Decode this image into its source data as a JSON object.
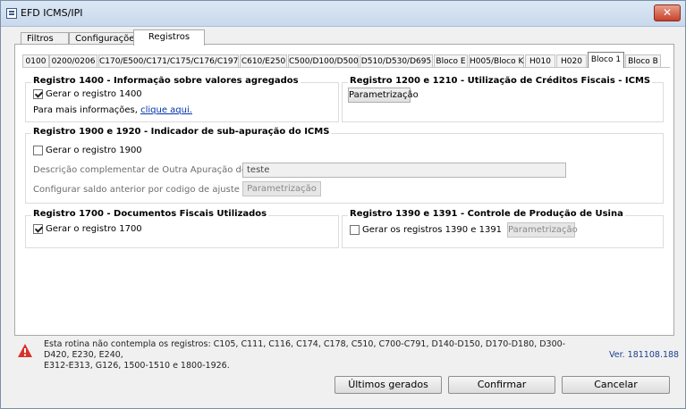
{
  "window": {
    "title": "EFD ICMS/IPI",
    "close_glyph": "✕"
  },
  "main_tabs": [
    {
      "label": "Filtros"
    },
    {
      "label": "Configurações"
    },
    {
      "label": "Registros",
      "active": true
    }
  ],
  "sub_tabs": [
    {
      "label": "0100"
    },
    {
      "label": "0200/0206"
    },
    {
      "label": "C170/E500/C171/C175/C176/C197"
    },
    {
      "label": "C610/E250"
    },
    {
      "label": "C500/D100/D500"
    },
    {
      "label": "D510/D530/D695"
    },
    {
      "label": "Bloco E"
    },
    {
      "label": "H005/Bloco K"
    },
    {
      "label": "H010"
    },
    {
      "label": "H020"
    },
    {
      "label": "Bloco 1",
      "active": true
    },
    {
      "label": "Bloco B"
    }
  ],
  "group_1400": {
    "title": "Registro 1400 - Informação sobre valores agregados",
    "checkbox_label": "Gerar o registro 1400",
    "checked": true,
    "info_text": "Para mais informações,",
    "link_text": "clique aqui."
  },
  "group_1200": {
    "title": "Registro 1200 e 1210 - Utilização de Créditos Fiscais - ICMS",
    "button_label": "Parametrização"
  },
  "group_1900": {
    "title": "Registro 1900 e 1920 - Indicador de sub-apuração do ICMS",
    "checkbox_label": "Gerar o registro 1900",
    "checked": false,
    "desc_label": "Descrição complementar de Outra Apuração do ICMS",
    "desc_value": "teste",
    "config_label": "Configurar saldo anterior por codigo de ajuste",
    "button_label": "Parametrização"
  },
  "group_1700": {
    "title": "Registro 1700 - Documentos Fiscais Utilizados",
    "checkbox_label": "Gerar o registro 1700",
    "checked": true
  },
  "group_1390": {
    "title": "Registro 1390 e 1391 - Controle de Produção de Usina",
    "checkbox_label": "Gerar os registros 1390 e 1391",
    "checked": false,
    "button_label": "Parametrização"
  },
  "footer": {
    "message_line1": "Esta rotina não contempla os registros: C105, C111, C116, C174, C178, C510, C700-C791, D140-D150, D170-D180, D300-D420, E230, E240,",
    "message_line2": "E312-E313, G126, 1500-1510 e 1800-1926.",
    "version": "Ver. 181108.188",
    "warning_icon": "warning-triangle-icon",
    "buttons": {
      "ultimos": "Últimos gerados",
      "confirmar": "Confirmar",
      "cancelar": "Cancelar"
    }
  }
}
